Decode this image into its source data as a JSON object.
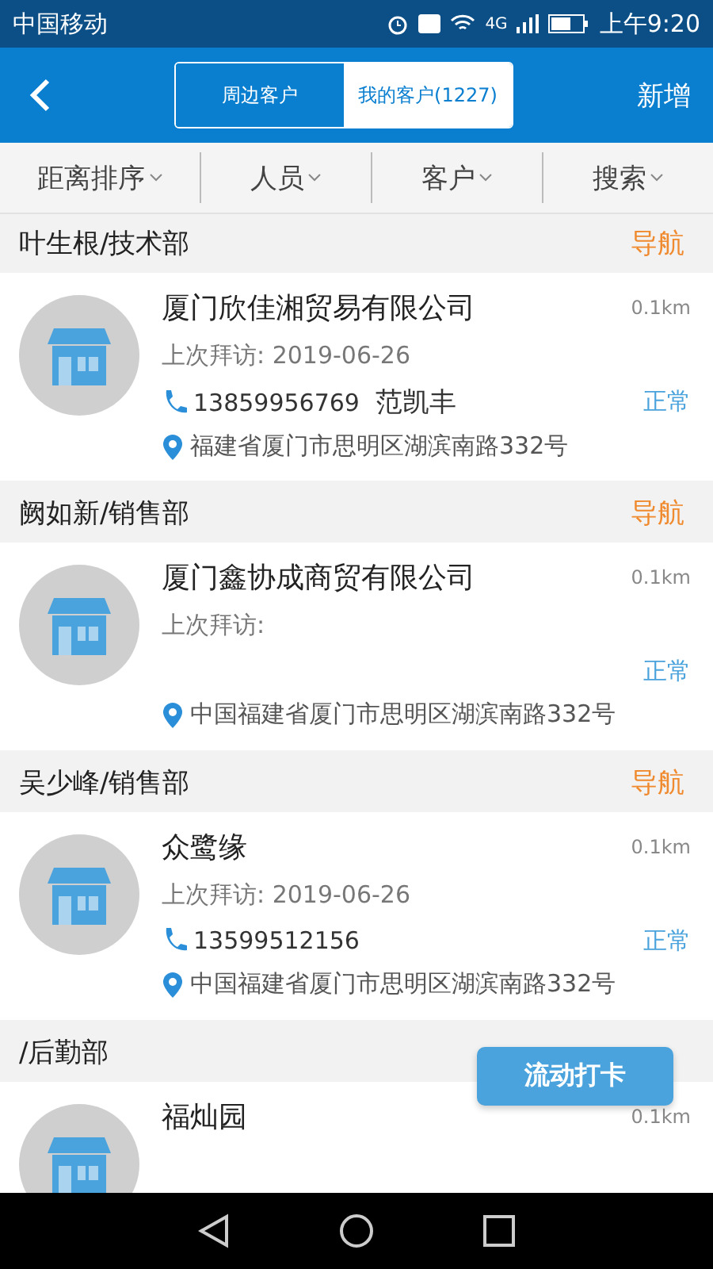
{
  "status_bar": {
    "carrier": "中国移动",
    "network": "4G",
    "time": "上午9:20"
  },
  "header": {
    "tabs": [
      {
        "label": "周边客户",
        "selected": false
      },
      {
        "label": "我的客户(1227)",
        "selected": true
      }
    ],
    "action": "新增"
  },
  "filters": [
    "距离排序",
    "人员",
    "客户",
    "搜索"
  ],
  "groups": [
    {
      "title": "叶生根/技术部",
      "nav": "导航",
      "customer": {
        "name": "厦门欣佳湘贸易有限公司",
        "distance": "0.1km",
        "last_visit_label": "上次拜访:",
        "last_visit": "2019-06-26",
        "phone": "13859956769",
        "contact": "范凯丰",
        "status": "正常",
        "address": "福建省厦门市思明区湖滨南路332号"
      }
    },
    {
      "title": "阙如新/销售部",
      "nav": "导航",
      "customer": {
        "name": "厦门鑫协成商贸有限公司",
        "distance": "0.1km",
        "last_visit_label": "上次拜访:",
        "status": "正常",
        "address": "中国福建省厦门市思明区湖滨南路332号"
      }
    },
    {
      "title": "吴少峰/销售部",
      "nav": "导航",
      "customer": {
        "name": "众鹭缘",
        "distance": "0.1km",
        "last_visit_label": "上次拜访:",
        "last_visit": "2019-06-26",
        "phone": "13599512156",
        "status": "正常",
        "address": "中国福建省厦门市思明区湖滨南路332号"
      }
    },
    {
      "title": "/后勤部",
      "customer": {
        "name": "福灿园",
        "distance": "0.1km"
      }
    }
  ],
  "fab": "流动打卡"
}
